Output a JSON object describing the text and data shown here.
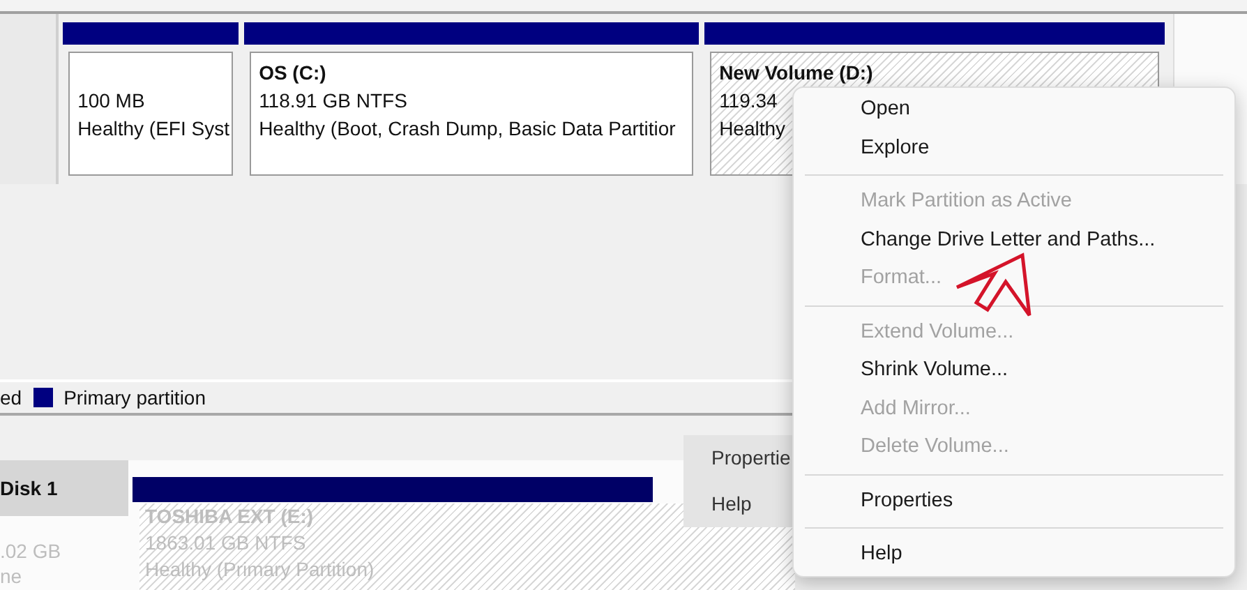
{
  "disk": {
    "partitions": [
      {
        "size": "100 MB",
        "status": "Healthy (EFI Syst",
        "selected": false
      },
      {
        "name": "OS  (C:)",
        "size": "118.91 GB NTFS",
        "status": "Healthy (Boot, Crash Dump, Basic Data Partitior",
        "selected": false
      },
      {
        "name": "New Volume  (D:)",
        "size": "119.34",
        "status": "Healthy",
        "selected": true
      }
    ]
  },
  "legend": {
    "cut_label": "ed",
    "label": "Primary partition",
    "color": "#000080"
  },
  "lower_disk": {
    "label": "Disk 1",
    "capacity": ".02 GB",
    "state": "ne",
    "partition": {
      "name": "TOSHIBA EXT  (E:)",
      "size": "1863.01 GB NTFS",
      "status": "Healthy (Primary Partition)"
    }
  },
  "background_menu": {
    "items": [
      "Propertie",
      "Help"
    ]
  },
  "context_menu": {
    "groups": [
      [
        {
          "label": "Open",
          "disabled": false
        },
        {
          "label": "Explore",
          "disabled": false
        }
      ],
      [
        {
          "label": "Mark Partition as Active",
          "disabled": true
        },
        {
          "label": "Change Drive Letter and Paths...",
          "disabled": false
        },
        {
          "label": "Format...",
          "disabled": true
        }
      ],
      [
        {
          "label": "Extend Volume...",
          "disabled": true
        },
        {
          "label": "Shrink Volume...",
          "disabled": false
        },
        {
          "label": "Add Mirror...",
          "disabled": true
        },
        {
          "label": "Delete Volume...",
          "disabled": true
        }
      ],
      [
        {
          "label": "Properties",
          "disabled": false
        }
      ],
      [
        {
          "label": "Help",
          "disabled": false
        }
      ]
    ]
  }
}
